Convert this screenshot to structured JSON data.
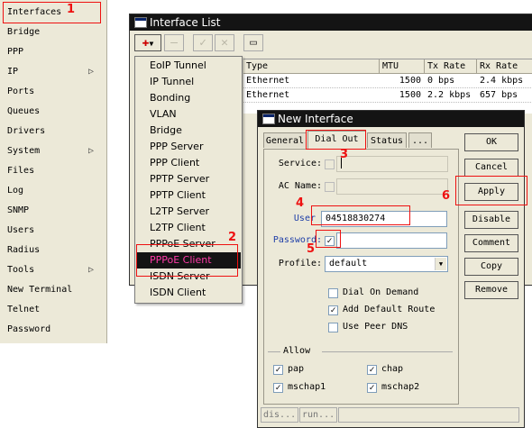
{
  "left_menu": {
    "items": [
      {
        "label": "Interfaces"
      },
      {
        "label": "Bridge"
      },
      {
        "label": "PPP"
      },
      {
        "label": "IP",
        "arrow": "▷"
      },
      {
        "label": "Ports"
      },
      {
        "label": "Queues"
      },
      {
        "label": "Drivers"
      },
      {
        "label": "System",
        "arrow": "▷"
      },
      {
        "label": "Files"
      },
      {
        "label": "Log"
      },
      {
        "label": "SNMP"
      },
      {
        "label": "Users"
      },
      {
        "label": "Radius"
      },
      {
        "label": "Tools",
        "arrow": "▷"
      },
      {
        "label": "New Terminal"
      },
      {
        "label": "Telnet"
      },
      {
        "label": "Password"
      }
    ]
  },
  "interface_list": {
    "title": "Interface List",
    "columns": [
      "Type",
      "MTU",
      "Tx Rate",
      "Rx Rate"
    ],
    "rows": [
      {
        "type": "Ethernet",
        "mtu": "1500",
        "tx": "0 bps",
        "rx": "2.4 kbps"
      },
      {
        "type": "Ethernet",
        "mtu": "1500",
        "tx": "2.2 kbps",
        "rx": "657 bps"
      }
    ]
  },
  "add_menu": {
    "items": [
      "EoIP Tunnel",
      "IP Tunnel",
      "Bonding",
      "VLAN",
      "Bridge",
      "PPP Server",
      "PPP Client",
      "PPTP Server",
      "PPTP Client",
      "L2TP Server",
      "L2TP Client",
      "PPPoE Server",
      "PPPoE Client",
      "ISDN Server",
      "ISDN Client"
    ],
    "selected": "PPPoE Client"
  },
  "new_interface": {
    "title": "New Interface",
    "tabs": [
      "General",
      "Dial Out",
      "Status",
      "..."
    ],
    "active_tab": "Dial Out",
    "service_label": "Service:",
    "ac_name_label": "AC Name:",
    "user_label": "User",
    "user_value": "04518830274",
    "password_label": "Password:",
    "profile_label": "Profile:",
    "profile_value": "default",
    "options": [
      {
        "label": "Dial On Demand",
        "checked": false
      },
      {
        "label": "Add Default Route",
        "checked": true
      },
      {
        "label": "Use Peer DNS",
        "checked": false
      }
    ],
    "allow_title": "Allow",
    "allow": [
      {
        "label": "pap",
        "checked": true
      },
      {
        "label": "chap",
        "checked": true
      },
      {
        "label": "mschap1",
        "checked": true
      },
      {
        "label": "mschap2",
        "checked": true
      }
    ],
    "buttons": [
      "OK",
      "Cancel",
      "Apply",
      "Disable",
      "Comment",
      "Copy",
      "Remove"
    ],
    "status": [
      "dis...",
      "run..."
    ]
  },
  "annotations": [
    "1",
    "2",
    "3",
    "4",
    "5",
    "6"
  ],
  "colors": {
    "annotation": "#e11111",
    "selected_text": "#ff3aa8",
    "user_label": "#1f3fa8"
  }
}
